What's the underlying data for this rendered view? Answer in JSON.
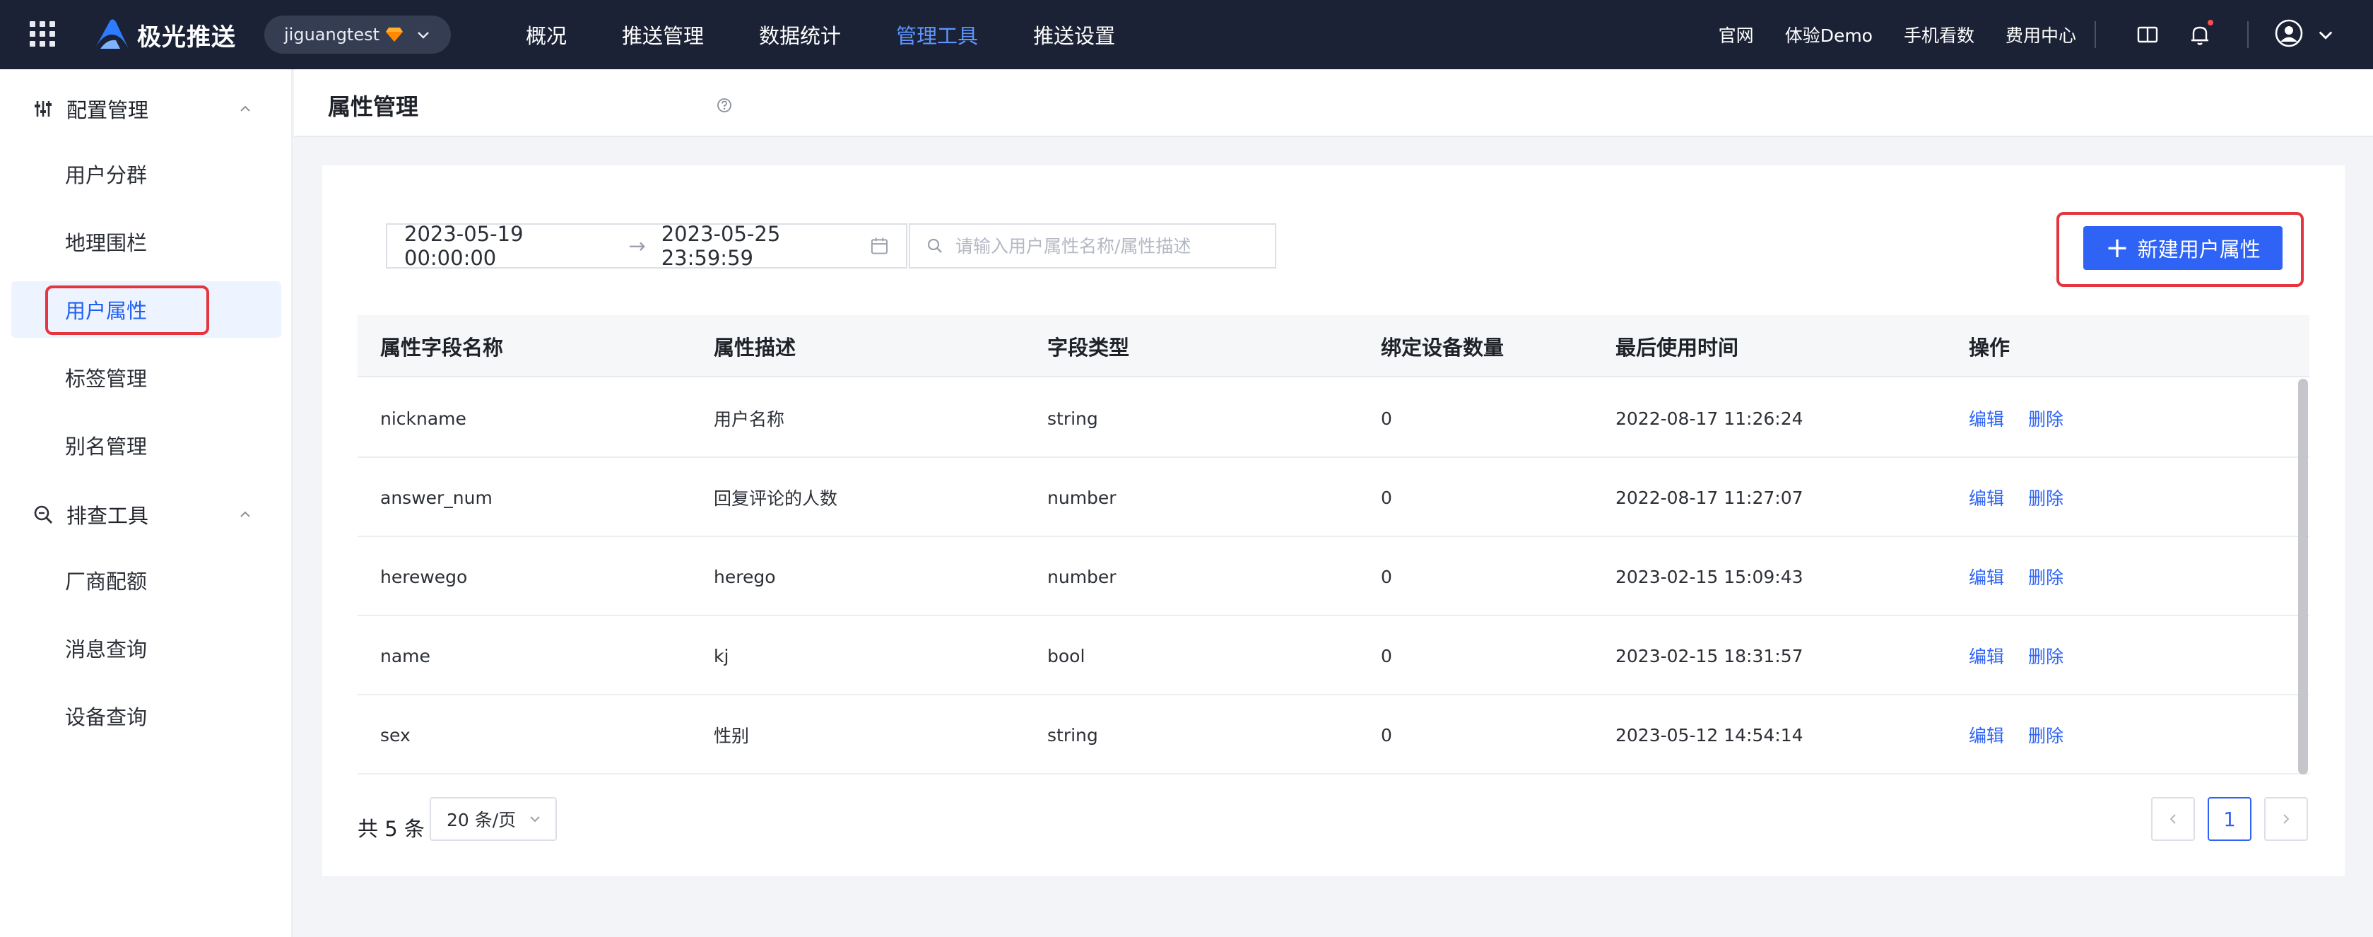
{
  "topbar": {
    "brand": "极光推送",
    "app_name": "jiguangtest",
    "nav": [
      "概况",
      "推送管理",
      "数据统计",
      "管理工具",
      "推送设置"
    ],
    "nav_active": "管理工具",
    "links": [
      "官网",
      "体验Demo",
      "手机看数",
      "费用中心"
    ],
    "icons": [
      "grid-icon",
      "book-icon",
      "bell-icon",
      "user-avatar-icon",
      "chevron-down-icon"
    ]
  },
  "sidebar": {
    "group1": "配置管理",
    "group1_items": [
      "用户分群",
      "地理围栏",
      "用户属性",
      "标签管理",
      "别名管理"
    ],
    "group2": "排查工具",
    "group2_items": [
      "厂商配额",
      "消息查询",
      "设备查询"
    ],
    "active": "用户属性"
  },
  "page": {
    "title": "属性管理"
  },
  "filters": {
    "date_start": "2023-05-19 00:00:00",
    "date_end": "2023-05-25 23:59:59",
    "search_placeholder": "请输入用户属性名称/属性描述",
    "new_button": "新建用户属性"
  },
  "table": {
    "columns": [
      "属性字段名称",
      "属性描述",
      "字段类型",
      "绑定设备数量",
      "最后使用时间",
      "操作"
    ],
    "rows": [
      {
        "name": "nickname",
        "desc": "用户名称",
        "type": "string",
        "count": "0",
        "time": "2022-08-17 11:26:24"
      },
      {
        "name": "answer_num",
        "desc": "回复评论的人数",
        "type": "number",
        "count": "0",
        "time": "2022-08-17 11:27:07"
      },
      {
        "name": "herewego",
        "desc": "herego",
        "type": "number",
        "count": "0",
        "time": "2023-02-15 15:09:43"
      },
      {
        "name": "name",
        "desc": "kj",
        "type": "bool",
        "count": "0",
        "time": "2023-02-15 18:31:57"
      },
      {
        "name": "sex",
        "desc": "性别",
        "type": "string",
        "count": "0",
        "time": "2023-05-12 14:54:14"
      }
    ],
    "edit_label": "编辑",
    "delete_label": "删除"
  },
  "pagination": {
    "total": "共 5 条",
    "page_size": "20 条/页",
    "current_page": "1"
  },
  "colors": {
    "topbar": "#1b2235",
    "accent": "#2e63f5",
    "highlight": "#e5363f"
  }
}
